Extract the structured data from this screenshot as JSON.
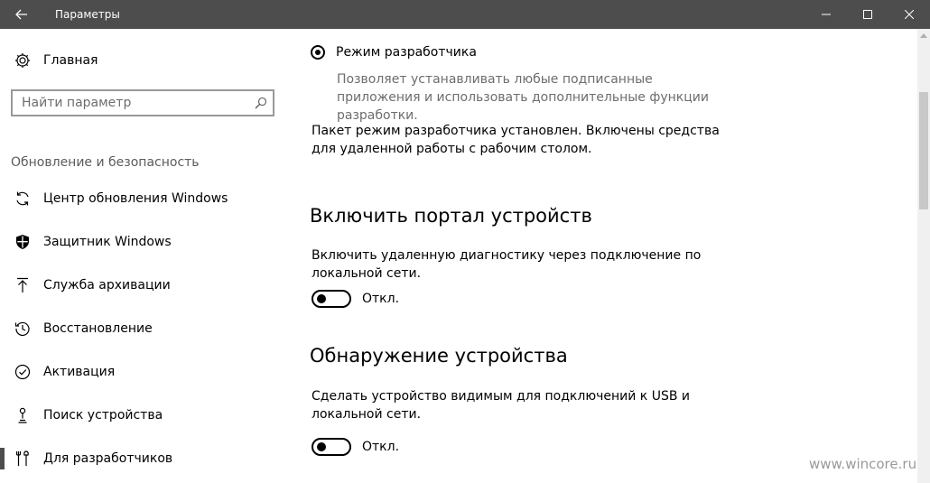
{
  "window": {
    "title": "Параметры"
  },
  "sidebar": {
    "home_label": "Главная",
    "search_placeholder": "Найти параметр",
    "section_title": "Обновление и безопасность",
    "items": [
      {
        "label": "Центр обновления Windows",
        "icon": "sync-icon"
      },
      {
        "label": "Защитник Windows",
        "icon": "shield-icon"
      },
      {
        "label": "Служба архивации",
        "icon": "upload-arrow-icon"
      },
      {
        "label": "Восстановление",
        "icon": "history-icon"
      },
      {
        "label": "Активация",
        "icon": "check-circle-icon"
      },
      {
        "label": "Поиск устройства",
        "icon": "person-pin-icon"
      },
      {
        "label": "Для разработчиков",
        "icon": "tools-icon",
        "selected": true
      }
    ]
  },
  "content": {
    "developer_mode": {
      "label": "Режим разработчика",
      "selected": true,
      "description": "Позволяет устанавливать любые подписанные приложения и использовать дополнительные функции разработки."
    },
    "package_status": "Пакет режим разработчика установлен. Включены средства для удаленной работы с рабочим столом.",
    "device_portal": {
      "heading": "Включить портал устройств",
      "description": "Включить удаленную диагностику через подключение по локальной сети.",
      "toggle_label": "Откл.",
      "toggle_on": false
    },
    "device_discovery": {
      "heading": "Обнаружение устройства",
      "description": "Сделать устройство видимым для подключений к USB и локальной сети.",
      "toggle_label": "Откл.",
      "toggle_on": false
    }
  },
  "watermark": "www.wincore.ru",
  "colors": {
    "titlebar": "#4d4d4d",
    "secondary_text": "#6d6d6d",
    "section_text": "#5c5c5c"
  }
}
